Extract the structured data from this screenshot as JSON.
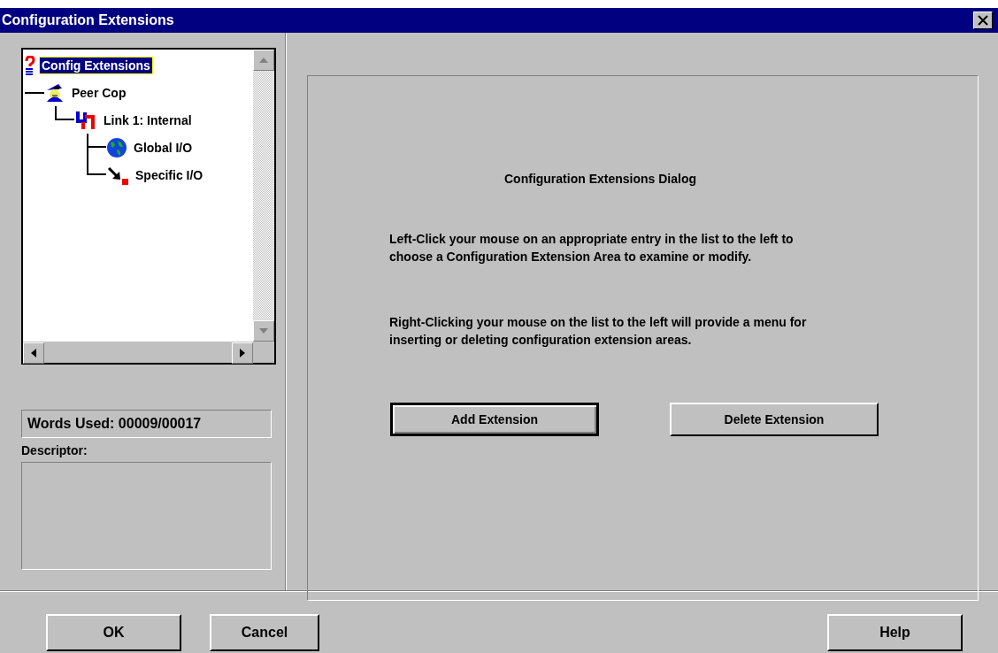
{
  "window": {
    "title": "Configuration Extensions"
  },
  "tree": [
    {
      "label": "Config Extensions",
      "kind": "root",
      "selected": true,
      "children": [
        {
          "label": "Peer Cop",
          "kind": "cop",
          "selected": false,
          "children": [
            {
              "label": "Link 1: Internal",
              "kind": "link",
              "selected": false,
              "children": [
                {
                  "label": "Global I/O",
                  "kind": "globe",
                  "selected": false
                },
                {
                  "label": "Specific I/O",
                  "kind": "arrow",
                  "selected": false
                }
              ]
            }
          ]
        }
      ]
    }
  ],
  "words_used": "Words Used: 00009/00017",
  "descriptor": {
    "label": "Descriptor:"
  },
  "dialog": {
    "heading": "Configuration Extensions Dialog",
    "paragraphs": [
      "Left-Click your mouse on an appropriate entry in the list to the left to choose a Configuration Extension Area to examine or modify.",
      "Right-Clicking your mouse on the list to the left will provide a menu for inserting or deleting configuration extension areas."
    ],
    "buttons": [
      {
        "label": "Add Extension",
        "focused": true
      },
      {
        "label": "Delete Extension",
        "focused": false
      }
    ]
  },
  "footer_buttons": [
    "OK",
    "Cancel",
    "Help"
  ]
}
